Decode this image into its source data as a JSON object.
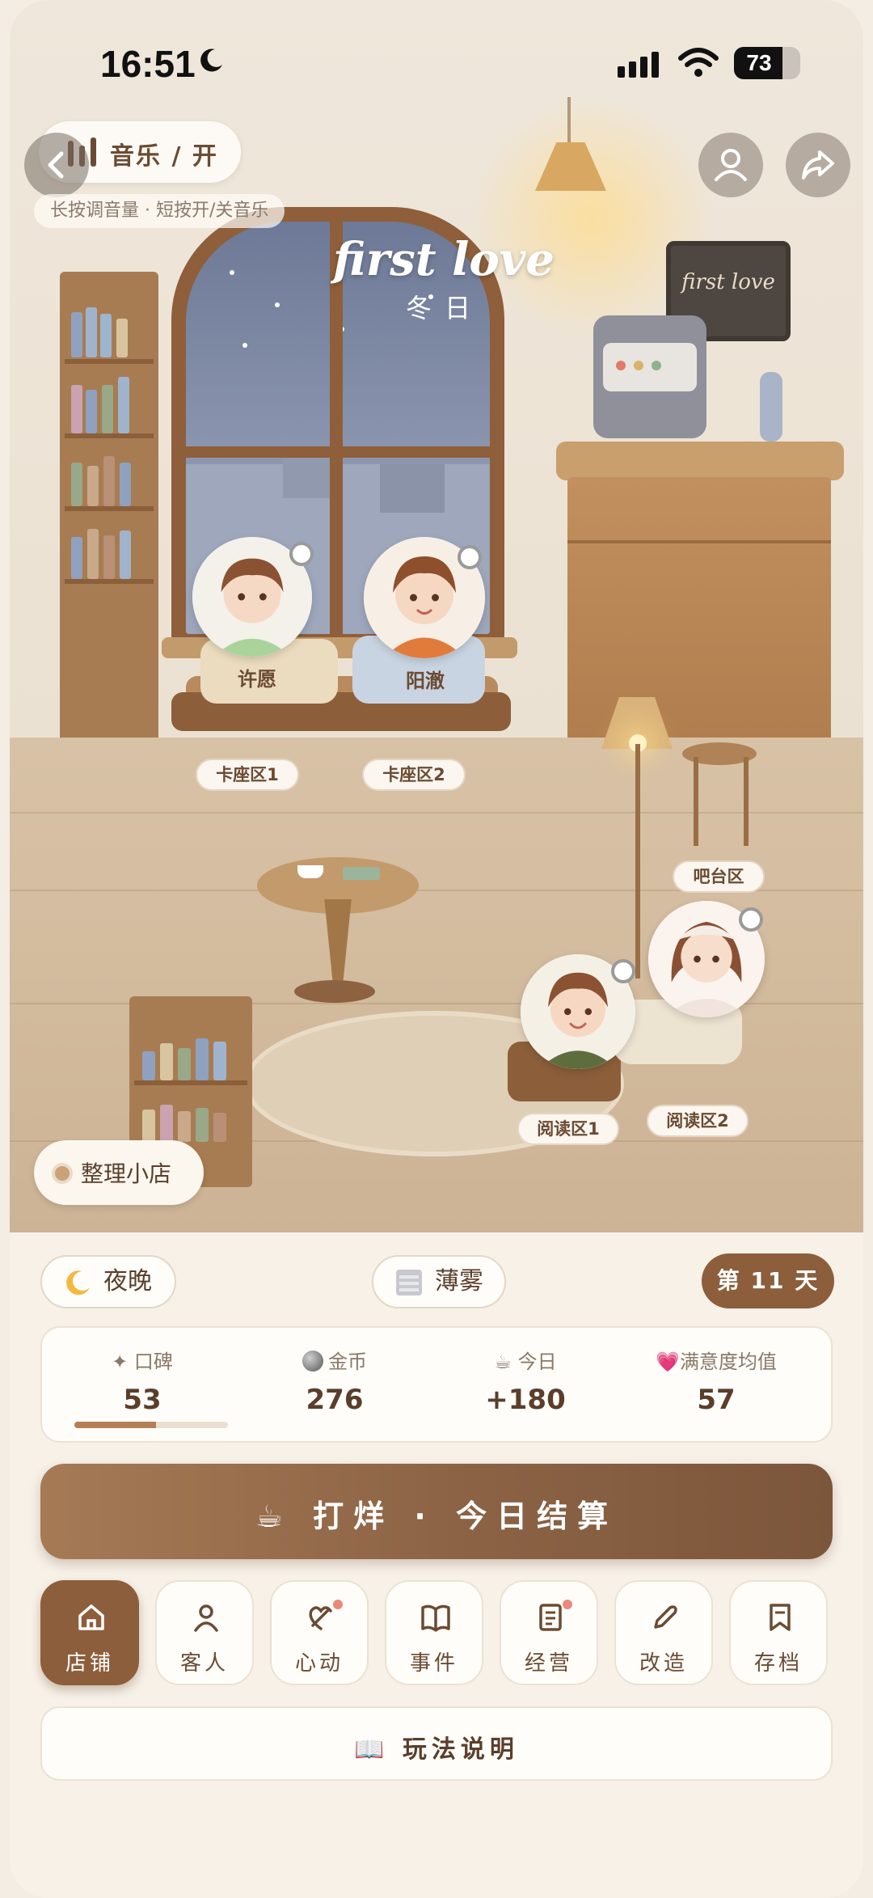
{
  "status_bar": {
    "time": "16:51",
    "battery": "73",
    "battery_level": 0.73
  },
  "scene": {
    "title_en": "first love",
    "title_zh": "冬日",
    "sign_text": "first love",
    "music_label": "音乐 / 开",
    "music_hint": "长按调音量 · 短按开/关音乐",
    "tidy_label": "整理小店",
    "seats": [
      {
        "zone": "卡座区1",
        "guest": "许愿"
      },
      {
        "zone": "卡座区2",
        "guest": "阳澈"
      },
      {
        "zone": "吧台区",
        "guest": ""
      },
      {
        "zone": "阅读区1",
        "guest": ""
      },
      {
        "zone": "阅读区2",
        "guest": ""
      }
    ]
  },
  "info": {
    "time_of_day": "夜晚",
    "weather": "薄雾",
    "day": "第 11 天"
  },
  "stats": [
    {
      "label": "口碑",
      "value": "53",
      "progress": 0.53
    },
    {
      "label": "金币",
      "value": "276"
    },
    {
      "label": "今日",
      "value": "+180"
    },
    {
      "label": "满意度均值",
      "value": "57"
    }
  ],
  "main_action": "☕  打烊 · 今日结算",
  "nav": [
    {
      "label": "店铺",
      "icon": "home-icon",
      "active": true
    },
    {
      "label": "客人",
      "icon": "person-icon"
    },
    {
      "label": "心动",
      "icon": "heart-icon",
      "badge": true
    },
    {
      "label": "事件",
      "icon": "book-icon"
    },
    {
      "label": "经营",
      "icon": "ledger-icon",
      "badge": true
    },
    {
      "label": "改造",
      "icon": "pencil-icon"
    },
    {
      "label": "存档",
      "icon": "bookmark-icon"
    }
  ],
  "help_label": "📖  玩法说明",
  "colors": {
    "accent": "#8d5e3b",
    "background": "#f7f1e8",
    "text": "#5a3e2b"
  }
}
